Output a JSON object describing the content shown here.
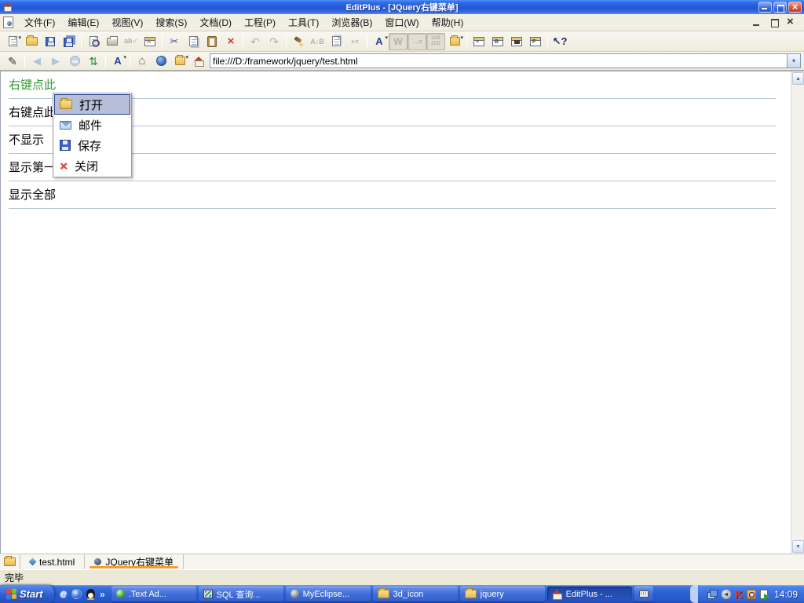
{
  "window": {
    "title": "EditPlus - [JQuery右键菜单]",
    "controls": [
      "minimize",
      "restore",
      "close"
    ]
  },
  "menu_bar": {
    "items": [
      {
        "label": "文件(F)"
      },
      {
        "label": "编辑(E)"
      },
      {
        "label": "视图(V)"
      },
      {
        "label": "搜索(S)"
      },
      {
        "label": "文档(D)"
      },
      {
        "label": "工程(P)"
      },
      {
        "label": "工具(T)"
      },
      {
        "label": "浏览器(B)"
      },
      {
        "label": "窗口(W)"
      },
      {
        "label": "帮助(H)"
      }
    ],
    "mdi_controls": [
      "minimize",
      "restore",
      "close"
    ]
  },
  "toolbar": {
    "icons": [
      "new-file-icon",
      "open-file-icon",
      "save-icon",
      "save-all-icon",
      "print-preview-icon",
      "print-icon",
      "spell-check-icon",
      "html-toolbar-icon",
      "cut-icon",
      "copy-icon",
      "paste-icon",
      "delete-icon",
      "undo-icon",
      "redo-icon",
      "highlight-icon",
      "sort-icon",
      "duplicate-icon",
      "indent-icon",
      "font-icon",
      "word-wrap-icon",
      "tab-stop-icon",
      "line-number-icon",
      "browser-open-icon",
      "cliptext-icon",
      "directory-window-icon",
      "output-window-icon",
      "function-list-icon",
      "context-help-icon"
    ],
    "glyphs": {
      "cut": "✂",
      "undo": "↶",
      "redo": "↷",
      "font": "A",
      "wrap": "W",
      "tabstop": "→≡",
      "linenum": "1A 2C",
      "sort": "A↓B",
      "help": "↖?",
      "spell": "abc✓",
      "html": "H"
    }
  },
  "browser_bar": {
    "icons": [
      "edit-source-icon",
      "back-icon",
      "forward-icon",
      "stop-icon",
      "refresh-icon",
      "text-size-icon",
      "home-icon",
      "search-icon",
      "favorites-folder-icon",
      "open-in-browser-icon"
    ],
    "glyphs": {
      "pencil": "✎",
      "back": "◀",
      "forward": "▶",
      "refresh": "⇅",
      "home": "⌂",
      "font": "A"
    },
    "address": "file:///D:/framework/jquery/test.html"
  },
  "content": {
    "lines": [
      {
        "text": "右键点此",
        "color": "green"
      },
      {
        "text": "右键点此",
        "color": "black"
      },
      {
        "text": "不显示",
        "color": "black"
      },
      {
        "text": "显示第一",
        "color": "black"
      },
      {
        "text": "显示全部",
        "color": "black"
      }
    ],
    "context_menu": {
      "items": [
        {
          "label": "打开",
          "icon": "folder-icon",
          "selected": true
        },
        {
          "label": "邮件",
          "icon": "mail-icon",
          "selected": false
        },
        {
          "label": "保存",
          "icon": "save-icon",
          "selected": false
        },
        {
          "label": "关闭",
          "icon": "close-icon",
          "selected": false
        }
      ]
    }
  },
  "tab_bar": {
    "tabs": [
      {
        "label": "test.html",
        "icon": "diamond-icon",
        "active": false
      },
      {
        "label": "JQuery右键菜单",
        "icon": "globe-icon",
        "active": true
      }
    ]
  },
  "status_bar": {
    "text": "完毕"
  },
  "taskbar": {
    "start_label": "Start",
    "quick_launch": [
      "ie-icon",
      "media-player-icon",
      "qq-penguin-icon",
      "chevron-icon"
    ],
    "chevron": "»",
    "tasks": [
      {
        "label": ".Text Ad...",
        "icon": "green-sphere-icon",
        "active": false
      },
      {
        "label": "SQL 查询...",
        "icon": "sql-window-icon",
        "active": false
      },
      {
        "label": "MyEclipse...",
        "icon": "gray-sphere-icon",
        "active": false
      },
      {
        "label": "3d_icon",
        "icon": "folder-icon",
        "active": false
      },
      {
        "label": "jquery",
        "icon": "folder-icon",
        "active": false
      },
      {
        "label": "EditPlus - ...",
        "icon": "editplus-icon",
        "active": true
      }
    ],
    "tray": {
      "icons": [
        "network-icon",
        "volume-icon",
        "kaspersky-icon",
        "search-tool-icon",
        "document-play-icon"
      ],
      "clock": "14:09"
    }
  },
  "colors": {
    "titlebar_blue": "#2a62e2",
    "taskbar_blue": "#2a60d4",
    "menu_highlight_bg": "#b6bed8",
    "menu_highlight_border": "#24408e",
    "green_text": "#339933",
    "hr_line": "#b5c4d2",
    "active_tab_underline": "#f0a030",
    "toolbar_face": "#f1efe2"
  }
}
